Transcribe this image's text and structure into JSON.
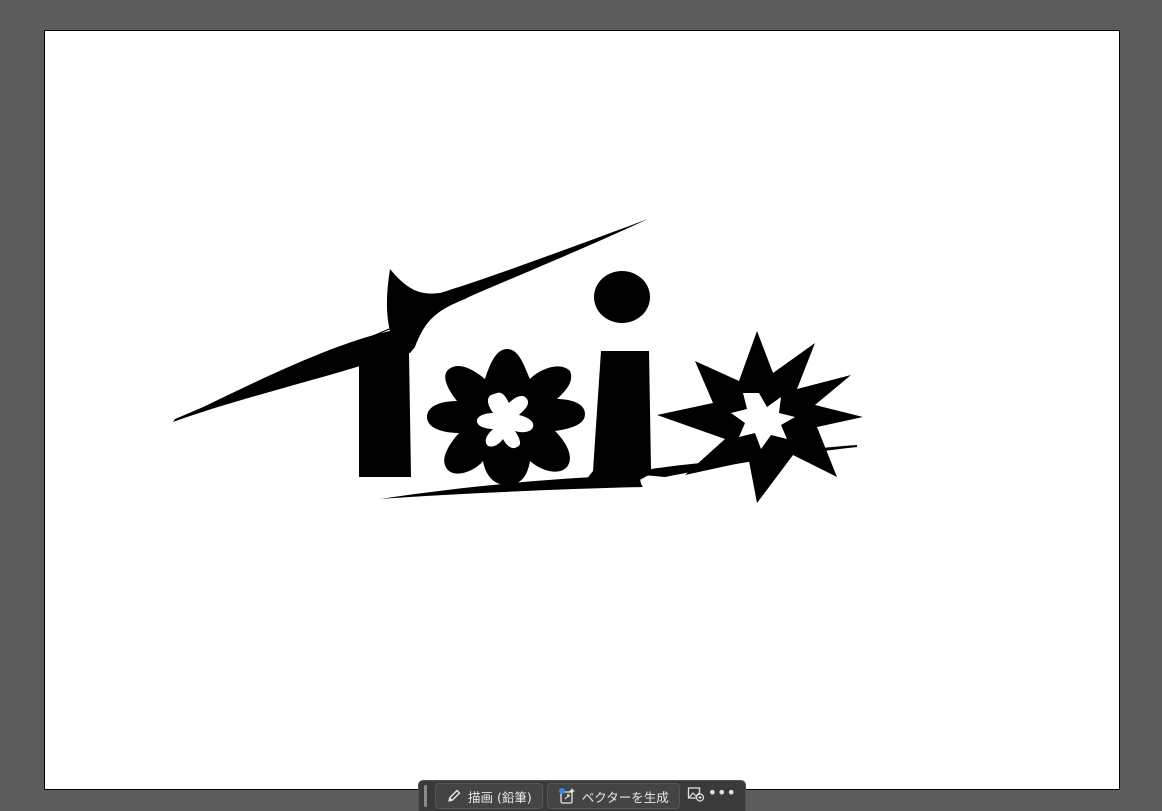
{
  "canvas": {
    "workspace_color": "#5c5c5c",
    "artboard_color": "#ffffff",
    "artwork_color": "#000000",
    "artwork_letters": "Taio"
  },
  "context_bar": {
    "draw_button": {
      "icon": "pencil-icon",
      "label": "描画 (鉛筆)"
    },
    "vectorize_button": {
      "icon": "generate-vector-icon",
      "label": "ベクターを生成"
    },
    "image_action_button": {
      "icon": "image-options-icon"
    },
    "more_button": {
      "icon": "more-icon",
      "label": "•••"
    }
  }
}
